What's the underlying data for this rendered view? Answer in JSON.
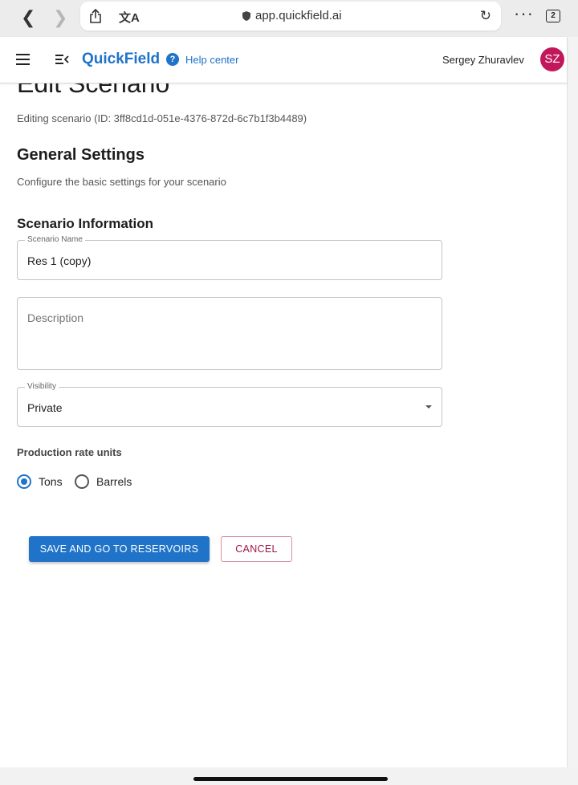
{
  "browser": {
    "url": "app.quickfield.ai",
    "tab_count": "2"
  },
  "header": {
    "brand": "QuickField",
    "help_label": "Help center",
    "user_name": "Sergey Zhuravlev",
    "avatar_initials": "SZ",
    "accent_color": "#1f73c8"
  },
  "page": {
    "title": "Edit Scenario",
    "subtitle": "Editing scenario (ID: 3ff8cd1d-051e-4376-872d-6c7b1f3b4489)",
    "section_title": "General Settings",
    "section_description": "Configure the basic settings for your scenario",
    "subsection_title": "Scenario Information"
  },
  "form": {
    "name_label": "Scenario Name",
    "name_value": "Res 1 (copy)",
    "description_placeholder": "Description",
    "visibility_label": "Visibility",
    "visibility_value": "Private",
    "rate_units_label": "Production rate units",
    "rate_units_options": [
      "Tons",
      "Barrels"
    ],
    "rate_units_selected": "Tons"
  },
  "actions": {
    "save_label": "SAVE AND GO TO RESERVOIRS",
    "cancel_label": "CANCEL"
  }
}
